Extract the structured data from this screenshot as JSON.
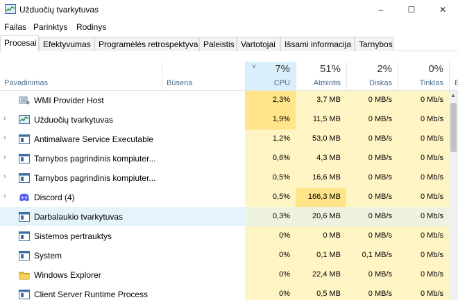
{
  "window": {
    "title": "Užduočių tvarkytuvas",
    "app_icon": "task-manager-icon",
    "controls": {
      "minimize": "–",
      "maximize": "☐",
      "close": "✕"
    }
  },
  "menu": {
    "items": [
      {
        "label": "Failas"
      },
      {
        "label": "Parinktys"
      },
      {
        "label": "Rodinys"
      }
    ]
  },
  "tabs": [
    {
      "label": "Procesai",
      "active": true
    },
    {
      "label": "Efektyvumas"
    },
    {
      "label": "Programėlės retrospektyva"
    },
    {
      "label": "Paleistis"
    },
    {
      "label": "Vartotojai"
    },
    {
      "label": "Išsami informacija"
    },
    {
      "label": "Tarnybos"
    }
  ],
  "columns": {
    "name": {
      "label": "Pavadinimas"
    },
    "status": {
      "label": "Būsena"
    },
    "cpu": {
      "pct": "7%",
      "label": "CPU",
      "sort_indicator": "˅"
    },
    "memory": {
      "pct": "51%",
      "label": "Atmintis"
    },
    "disk": {
      "pct": "2%",
      "label": "Diskas"
    },
    "network": {
      "pct": "0%",
      "label": "Tinklas"
    },
    "extra": {
      "label": "E"
    }
  },
  "processes": [
    {
      "name": "WMI Provider Host",
      "expandable": false,
      "icon": "wmi-icon",
      "cpu": "2,3%",
      "memory": "3,7 MB",
      "disk": "0 MB/s",
      "network": "0 Mb/s",
      "cpu_level": 2,
      "mem_level": 1
    },
    {
      "name": "Užduočių tvarkytuvas",
      "expandable": true,
      "icon": "task-manager-icon",
      "cpu": "1,9%",
      "memory": "11,5 MB",
      "disk": "0 MB/s",
      "network": "0 Mb/s",
      "cpu_level": 2,
      "mem_level": 1
    },
    {
      "name": "Antimalware Service Executable",
      "expandable": true,
      "icon": "service-icon",
      "cpu": "1,2%",
      "memory": "53,0 MB",
      "disk": "0 MB/s",
      "network": "0 Mb/s",
      "cpu_level": 1,
      "mem_level": 1
    },
    {
      "name": "Tarnybos pagrindinis kompiuter...",
      "expandable": true,
      "icon": "service-icon",
      "cpu": "0,6%",
      "memory": "4,3 MB",
      "disk": "0 MB/s",
      "network": "0 Mb/s",
      "cpu_level": 1,
      "mem_level": 1
    },
    {
      "name": "Tarnybos pagrindinis kompiuter...",
      "expandable": true,
      "icon": "service-icon",
      "cpu": "0,5%",
      "memory": "16,6 MB",
      "disk": "0 MB/s",
      "network": "0 Mb/s",
      "cpu_level": 1,
      "mem_level": 1
    },
    {
      "name": "Discord (4)",
      "expandable": true,
      "icon": "discord-icon",
      "cpu": "0,5%",
      "memory": "166,3 MB",
      "disk": "0 MB/s",
      "network": "0 Mb/s",
      "cpu_level": 1,
      "mem_level": 2
    },
    {
      "name": "Darbalaukio tvarkytuvas",
      "expandable": false,
      "icon": "service-icon",
      "cpu": "0,3%",
      "memory": "20,6 MB",
      "disk": "0 MB/s",
      "network": "0 Mb/s",
      "cpu_level": 1,
      "mem_level": 1,
      "selected": true
    },
    {
      "name": "Sistemos pertrauktys",
      "expandable": false,
      "icon": "service-icon",
      "cpu": "0%",
      "memory": "0 MB",
      "disk": "0 MB/s",
      "network": "0 Mb/s",
      "cpu_level": 1,
      "mem_level": 1
    },
    {
      "name": "System",
      "expandable": false,
      "icon": "service-icon",
      "cpu": "0%",
      "memory": "0,1 MB",
      "disk": "0,1 MB/s",
      "network": "0 Mb/s",
      "cpu_level": 1,
      "mem_level": 1
    },
    {
      "name": "Windows Explorer",
      "expandable": false,
      "icon": "folder-icon",
      "cpu": "0%",
      "memory": "22,4 MB",
      "disk": "0 MB/s",
      "network": "0 Mb/s",
      "cpu_level": 1,
      "mem_level": 1
    },
    {
      "name": "Client Server Runtime Process",
      "expandable": false,
      "icon": "service-icon",
      "cpu": "0%",
      "memory": "0,5 MB",
      "disk": "0 MB/s",
      "network": "0 Mb/s",
      "cpu_level": 1,
      "mem_level": 1
    }
  ],
  "colors": {
    "heat_light": "#fff4c4",
    "heat_medium": "#fff0b3",
    "heat_strong": "#ffe48a",
    "cpu_header": "#dbeefb",
    "selected_row": "#e5f3fb"
  }
}
